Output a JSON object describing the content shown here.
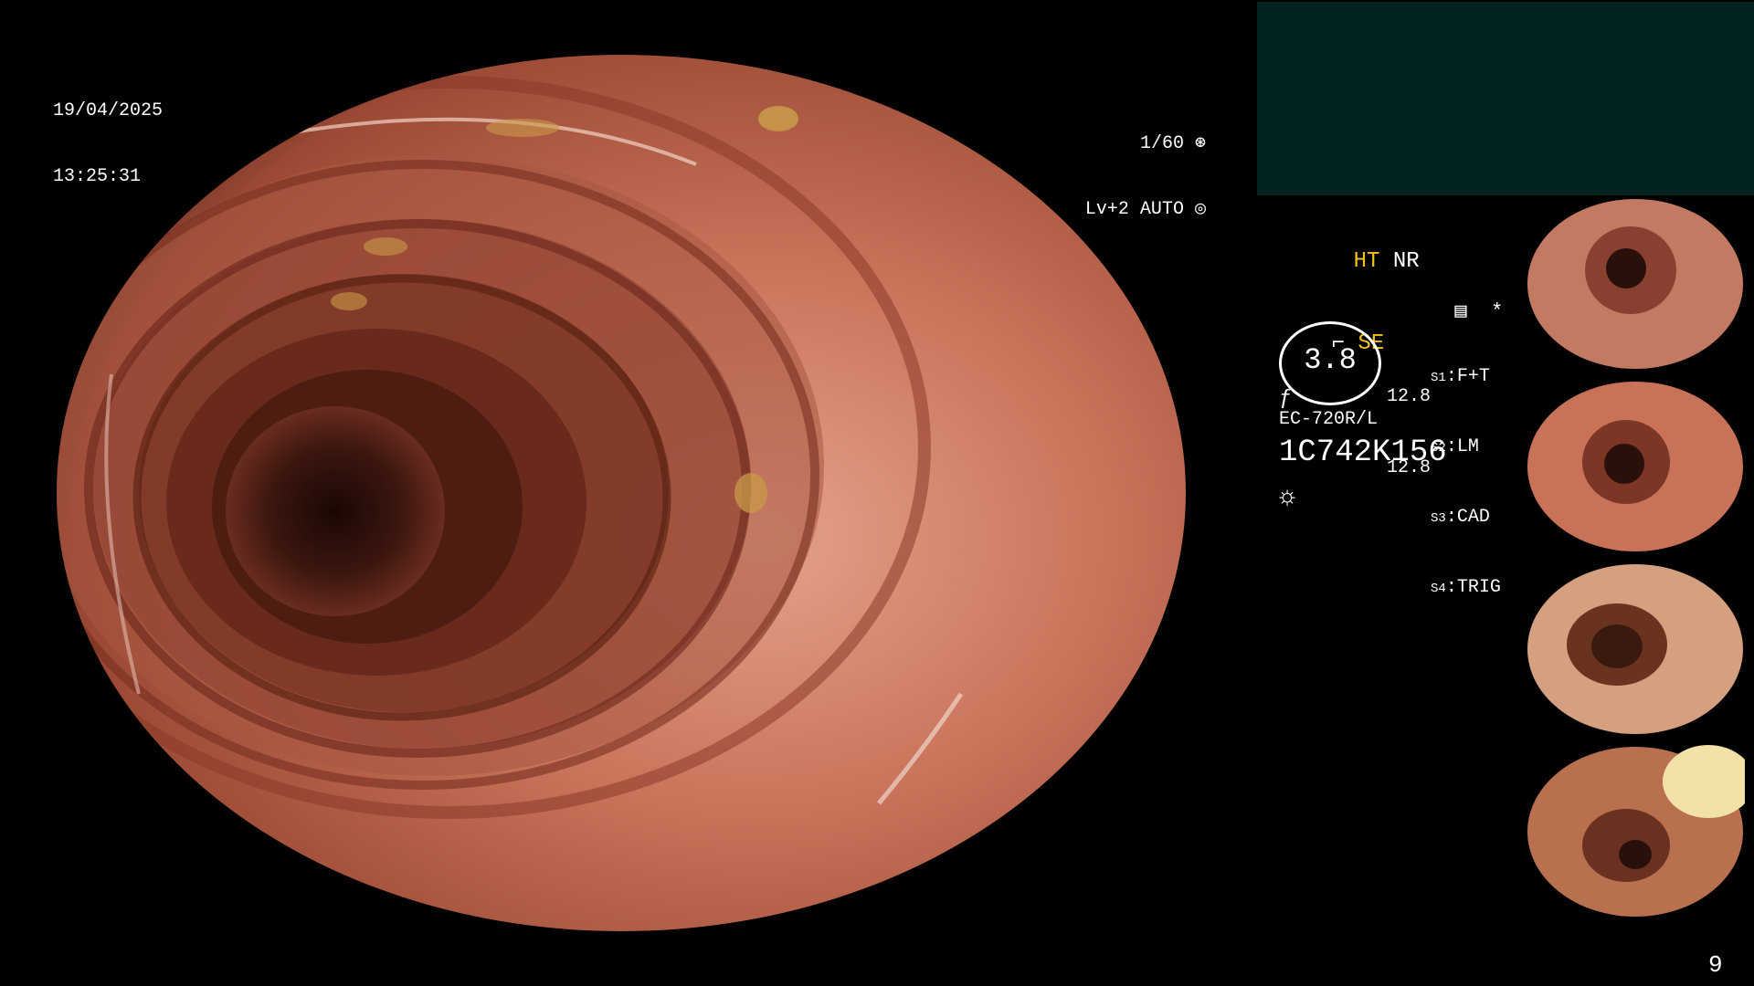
{
  "overlay": {
    "date": "19/04/2025",
    "time": "13:25:31",
    "shutter": "1/60",
    "level": "Lv+2 AUTO"
  },
  "settings": {
    "ht": "HT",
    "nr": "NR",
    "se": "SE",
    "zoom_value": "3.8",
    "val_a": "12.8",
    "val_b": "12.8",
    "switches": [
      {
        "key": "S1",
        "value": "F+T"
      },
      {
        "key": "S2",
        "value": "LM"
      },
      {
        "key": "S3",
        "value": "CAD"
      },
      {
        "key": "S4",
        "value": "TRIG"
      }
    ],
    "scope_model": "EC-720R/L",
    "scope_serial": "1C742K156",
    "asterisk": "*"
  },
  "page_number": "9",
  "colors": {
    "tissue": "#c06a4c",
    "lumen": "#2a100b",
    "panel": "#032321",
    "accent_yellow": "#f3c21a"
  }
}
